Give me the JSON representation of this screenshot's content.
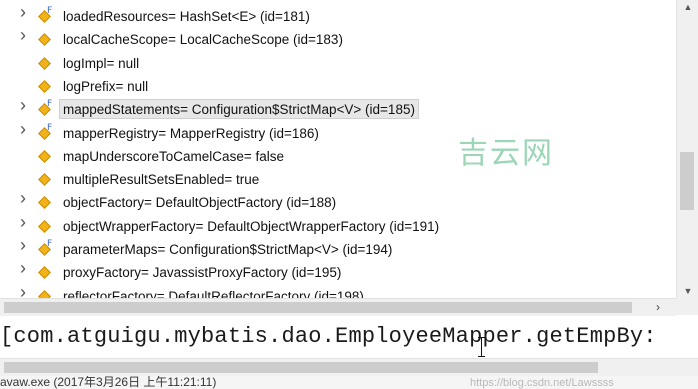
{
  "tree": {
    "rows": [
      {
        "label": "loadedResources= HashSet<E>  (id=181)",
        "expandable": true,
        "final": true,
        "selected": false
      },
      {
        "label": "localCacheScope= LocalCacheScope  (id=183)",
        "expandable": true,
        "final": false,
        "selected": false
      },
      {
        "label": "logImpl= null",
        "expandable": false,
        "final": false,
        "selected": false
      },
      {
        "label": "logPrefix= null",
        "expandable": false,
        "final": false,
        "selected": false
      },
      {
        "label": "mappedStatements= Configuration$StrictMap<V>  (id=185)",
        "expandable": true,
        "final": true,
        "selected": true
      },
      {
        "label": "mapperRegistry= MapperRegistry  (id=186)",
        "expandable": true,
        "final": true,
        "selected": false
      },
      {
        "label": "mapUnderscoreToCamelCase= false",
        "expandable": false,
        "final": false,
        "selected": false
      },
      {
        "label": "multipleResultSetsEnabled= true",
        "expandable": false,
        "final": false,
        "selected": false
      },
      {
        "label": "objectFactory= DefaultObjectFactory  (id=188)",
        "expandable": true,
        "final": false,
        "selected": false
      },
      {
        "label": "objectWrapperFactory= DefaultObjectWrapperFactory  (id=191)",
        "expandable": true,
        "final": false,
        "selected": false
      },
      {
        "label": "parameterMaps= Configuration$StrictMap<V>  (id=194)",
        "expandable": true,
        "final": true,
        "selected": false
      },
      {
        "label": "proxyFactory= JavassistProxyFactory  (id=195)",
        "expandable": true,
        "final": false,
        "selected": false
      },
      {
        "label": "reflectorFactory= DefaultReflectorFactory  (id=198)",
        "expandable": true,
        "final": false,
        "selected": false
      }
    ]
  },
  "detail": {
    "text": "[com.atguigu.mybatis.dao.EmployeeMapper.getEmpBy:"
  },
  "status": {
    "text": "avaw.exe (2017年3月26日 上午11:21:11)"
  },
  "watermark": {
    "brand": "吉云网",
    "url": "https://blog.csdn.net/Lawssss"
  },
  "scrollbars": {
    "up_arrow": "▲",
    "down_arrow": "▼",
    "left_arrow": "‹",
    "right_arrow": "›"
  },
  "icons": {
    "expand": "chevron-right-icon",
    "field": "field-diamond-icon",
    "final": "final-modifier-icon"
  },
  "colors": {
    "selected_row": "#e7e7e7",
    "field_icon": "#f2b318",
    "final_marker": "#3b69c7",
    "watermark": "#7bc9a0"
  }
}
